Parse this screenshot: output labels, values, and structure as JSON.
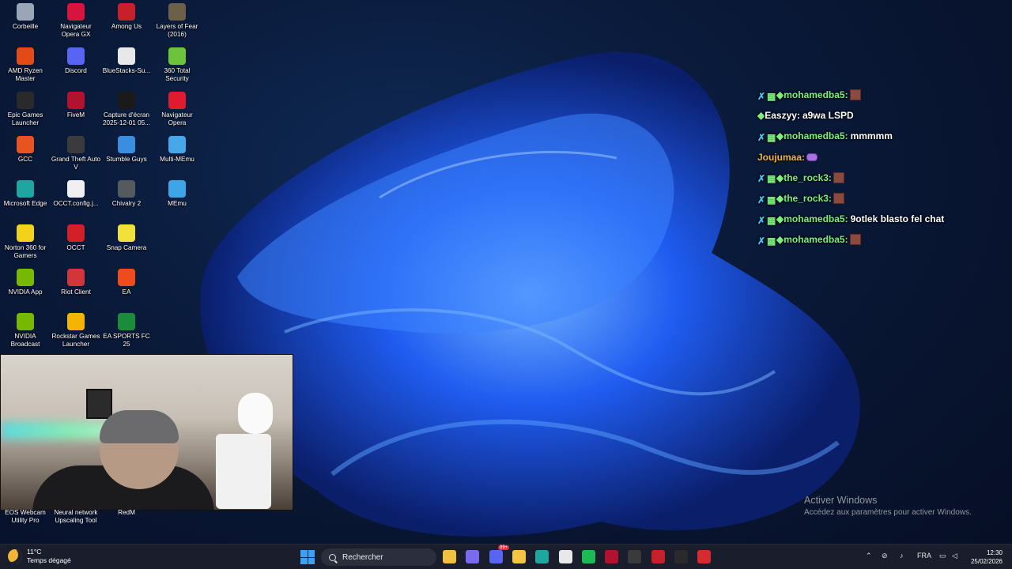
{
  "desktop": {
    "icons": [
      {
        "label": "Corbeille",
        "icon": "recycle-bin-icon",
        "color": "#9aa6b8"
      },
      {
        "label": "Navigateur Opera GX",
        "icon": "opera-gx-icon",
        "color": "#d8143c"
      },
      {
        "label": "Among Us",
        "icon": "among-us-icon",
        "color": "#c8202a"
      },
      {
        "label": "Layers of Fear (2016)",
        "icon": "layers-of-fear-icon",
        "color": "#6d6048"
      },
      {
        "label": "AMD Ryzen Master",
        "icon": "amd-ryzen-icon",
        "color": "#e24a18"
      },
      {
        "label": "Discord",
        "icon": "discord-icon",
        "color": "#5865f2"
      },
      {
        "label": "BlueStacks-Su...",
        "icon": "file-icon",
        "color": "#e8e8e8"
      },
      {
        "label": "360 Total Security",
        "icon": "360-security-icon",
        "color": "#6cc43a"
      },
      {
        "label": "Epic Games Launcher",
        "icon": "epic-games-icon",
        "color": "#2a2a2a"
      },
      {
        "label": "FiveM",
        "icon": "fivem-icon",
        "color": "#b3122e"
      },
      {
        "label": "Capture d'écran 2025-12-01 05...",
        "icon": "screenshot-icon",
        "color": "#1a1a1a"
      },
      {
        "label": "Navigateur Opera",
        "icon": "opera-icon",
        "color": "#e01b2f"
      },
      {
        "label": "GCC",
        "icon": "gcc-icon",
        "color": "#e85420"
      },
      {
        "label": "Grand Theft Auto V",
        "icon": "gta-icon",
        "color": "#3b3b3b"
      },
      {
        "label": "Stumble Guys",
        "icon": "stumble-guys-icon",
        "color": "#3a8ee0"
      },
      {
        "label": "Multi-MEmu",
        "icon": "memu-multi-icon",
        "color": "#46a8e8"
      },
      {
        "label": "Microsoft Edge",
        "icon": "edge-icon",
        "color": "#1fa6a0"
      },
      {
        "label": "OCCT.config.j...",
        "icon": "file-icon",
        "color": "#f0f0f0"
      },
      {
        "label": "Chivalry 2",
        "icon": "chivalry-icon",
        "color": "#555a5e"
      },
      {
        "label": "MEmu",
        "icon": "memu-icon",
        "color": "#3ea6e6"
      },
      {
        "label": "Norton 360 for Gamers",
        "icon": "norton-icon",
        "color": "#f2d21a"
      },
      {
        "label": "OCCT",
        "icon": "occt-icon",
        "color": "#d32028"
      },
      {
        "label": "Snap Camera",
        "icon": "snap-camera-icon",
        "color": "#f0e23a"
      },
      {
        "label": "",
        "icon": "",
        "color": ""
      },
      {
        "label": "NVIDIA App",
        "icon": "nvidia-icon",
        "color": "#76b900"
      },
      {
        "label": "Riot Client",
        "icon": "riot-icon",
        "color": "#d13639"
      },
      {
        "label": "EA",
        "icon": "ea-icon",
        "color": "#ef4c1e"
      },
      {
        "label": "",
        "icon": "",
        "color": ""
      },
      {
        "label": "NVIDIA Broadcast",
        "icon": "nvidia-broadcast-icon",
        "color": "#76b900"
      },
      {
        "label": "Rockstar Games Launcher",
        "icon": "rockstar-icon",
        "color": "#f5b400"
      },
      {
        "label": "EA SPORTS FC 25",
        "icon": "ea-fc-icon",
        "color": "#1a8c3a"
      },
      {
        "label": "",
        "icon": "",
        "color": ""
      }
    ],
    "bottom_labels": [
      "EOS Webcam Utility Pro",
      "Neural network Upscaling Tool",
      "RedM"
    ]
  },
  "chat": {
    "lines": [
      {
        "user": "mohamedba5:",
        "color": "#7cf07c",
        "badges": true,
        "msg": "",
        "emote": "pepe"
      },
      {
        "user": "Easzyy:",
        "color": "#ffffff",
        "badges": false,
        "msg": "a9wa LSPD",
        "emote": ""
      },
      {
        "user": "mohamedba5:",
        "color": "#7cf07c",
        "badges": true,
        "msg": "mmmmm",
        "emote": ""
      },
      {
        "user": "Joujumaa:",
        "color": "#f2b544",
        "badges": false,
        "msg": "",
        "emote": "bow"
      },
      {
        "user": "the_rock3:",
        "color": "#7cf07c",
        "badges": true,
        "msg": "",
        "emote": "pepe"
      },
      {
        "user": "the_rock3:",
        "color": "#7cf07c",
        "badges": true,
        "msg": "",
        "emote": "pepe"
      },
      {
        "user": "mohamedba5:",
        "color": "#7cf07c",
        "badges": true,
        "msg": "9otlek blasto fel chat",
        "emote": ""
      },
      {
        "user": "mohamedba5:",
        "color": "#7cf07c",
        "badges": true,
        "msg": "",
        "emote": "pepe"
      }
    ]
  },
  "watermark": {
    "title": "Activer Windows",
    "subtitle": "Accédez aux paramètres pour activer Windows."
  },
  "taskbar": {
    "weather_temp": "11°C",
    "weather_desc": "Temps dégagé",
    "search_placeholder": "Rechercher",
    "discord_badge": "99+",
    "language": "FRA",
    "time": "12:30",
    "date": "25/02/2026",
    "pinned": [
      {
        "name": "file-explorer-icon",
        "color": "#f0c040"
      },
      {
        "name": "copilot-icon",
        "color": "#7a6af0"
      },
      {
        "name": "discord-icon",
        "color": "#5865f2"
      },
      {
        "name": "folder-icon",
        "color": "#f4c542"
      },
      {
        "name": "edge-icon",
        "color": "#1fa6a0"
      },
      {
        "name": "store-icon",
        "color": "#e8e8e8"
      },
      {
        "name": "spotify-icon",
        "color": "#1db954"
      },
      {
        "name": "fivem-icon",
        "color": "#b3122e"
      },
      {
        "name": "obs-icon",
        "color": "#3a3a3a"
      },
      {
        "name": "roblox-icon",
        "color": "#c8202a"
      },
      {
        "name": "streamlabs-icon",
        "color": "#2a2a2a"
      },
      {
        "name": "redm-icon",
        "color": "#d42a30"
      }
    ]
  }
}
